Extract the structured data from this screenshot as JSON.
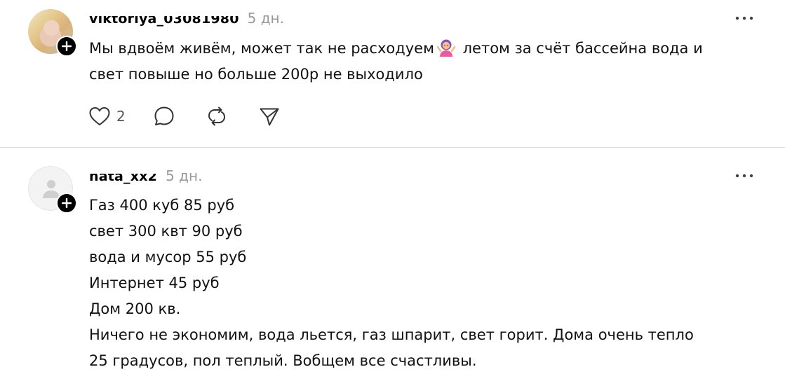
{
  "comments": [
    {
      "username": "viktoriya_03081980",
      "time": "5 дн.",
      "lines": [
        {
          "before": "Мы вдвоём живём, может так не расходуем",
          "emoji": "person-shrugging-emoji",
          "after": " летом за счёт бассейна вода и"
        },
        {
          "before": "свет повыше но больше 200р не выходило"
        }
      ],
      "like_count": "2"
    },
    {
      "username": "nata_xx2",
      "time": "5 дн.",
      "lines": [
        "Газ 400 куб 85 руб",
        "свет 300 квт 90 руб",
        "вода и мусор 55 руб",
        "Интернет 45 руб",
        "Дом 200 кв.",
        "Ничего не экономим, вода льется, газ шпарит, свет горит. Дома очень тепло",
        "25 градусов, пол теплый. Вобщем все счастливы."
      ]
    }
  ],
  "colors": {
    "timestamp": "#999999",
    "divider": "#dddddd",
    "icon": "#333333"
  }
}
